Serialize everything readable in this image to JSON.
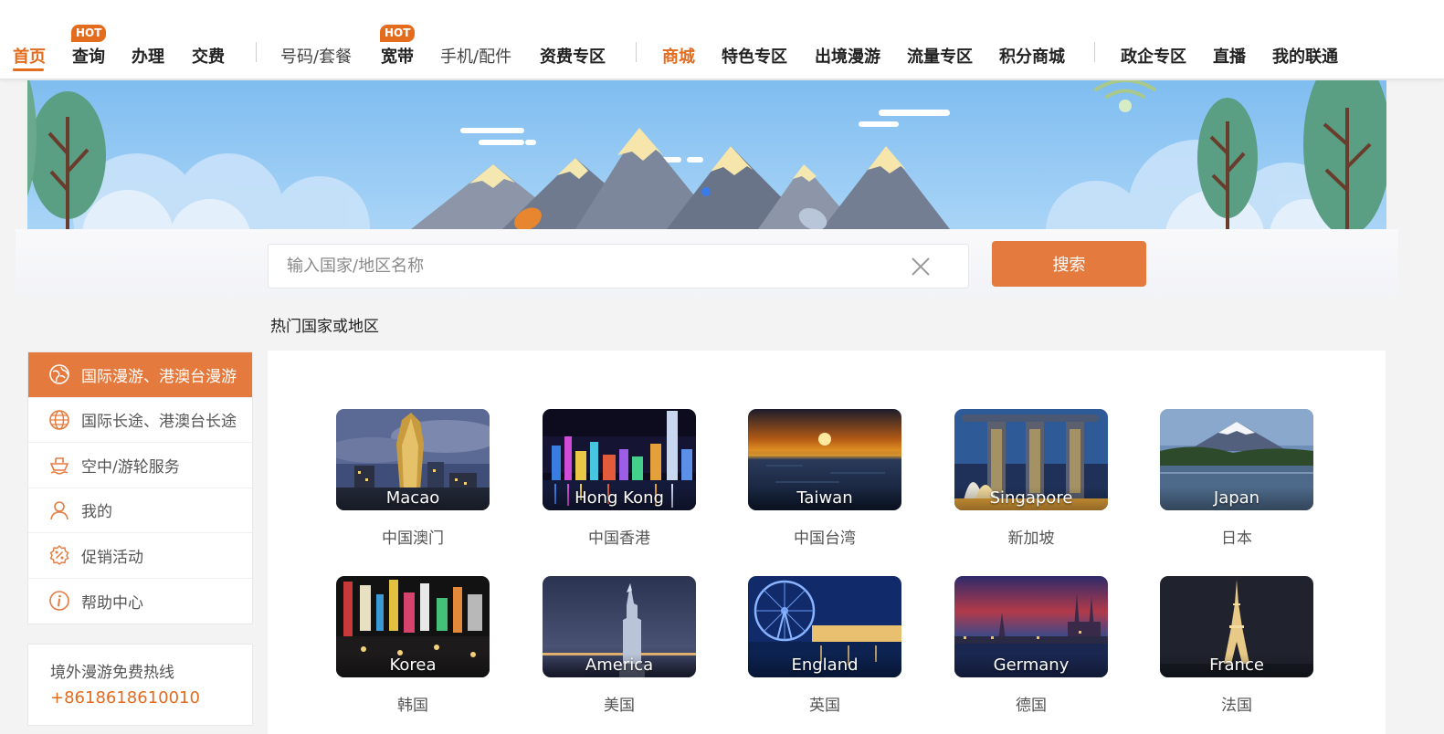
{
  "nav": {
    "items": [
      {
        "label": "首页",
        "hot": false
      },
      {
        "label": "查询",
        "hot": true
      },
      {
        "label": "办理",
        "hot": false
      },
      {
        "label": "交费",
        "hot": false
      },
      {
        "label": "号码/套餐",
        "hot": false
      },
      {
        "label": "宽带",
        "hot": true
      },
      {
        "label": "手机/配件",
        "hot": false
      },
      {
        "label": "资费专区",
        "hot": false
      },
      {
        "label": "商城",
        "hot": false
      },
      {
        "label": "特色专区",
        "hot": false
      },
      {
        "label": "出境漫游",
        "hot": false
      },
      {
        "label": "流量专区",
        "hot": false
      },
      {
        "label": "积分商城",
        "hot": false
      },
      {
        "label": "政企专区",
        "hot": false
      },
      {
        "label": "直播",
        "hot": false
      },
      {
        "label": "我的联通",
        "hot": false
      }
    ],
    "hot_badge": "HOT",
    "active_index": 0
  },
  "search": {
    "placeholder": "输入国家/地区名称",
    "value": "",
    "button_label": "搜索"
  },
  "hot_regions_title": "热门国家或地区",
  "sidebar": {
    "items": [
      {
        "label": "国际漫游、港澳台漫游",
        "icon": "globe-roaming-icon",
        "active": true
      },
      {
        "label": "国际长途、港澳台长途",
        "icon": "globe-icon",
        "active": false
      },
      {
        "label": "空中/游轮服务",
        "icon": "ship-icon",
        "active": false
      },
      {
        "label": "我的",
        "icon": "user-icon",
        "active": false
      },
      {
        "label": "促销活动",
        "icon": "discount-icon",
        "active": false
      },
      {
        "label": "帮助中心",
        "icon": "info-icon",
        "active": false
      }
    ]
  },
  "hotline": {
    "label": "境外漫游免费热线",
    "number": "+8618618610010"
  },
  "destinations": [
    {
      "en": "Macao",
      "cn": "中国澳门"
    },
    {
      "en": "Hong Kong",
      "cn": "中国香港"
    },
    {
      "en": "Taiwan",
      "cn": "中国台湾"
    },
    {
      "en": "Singapore",
      "cn": "新加坡"
    },
    {
      "en": "Japan",
      "cn": "日本"
    },
    {
      "en": "Korea",
      "cn": "韩国"
    },
    {
      "en": "America",
      "cn": "美国"
    },
    {
      "en": "England",
      "cn": "英国"
    },
    {
      "en": "Germany",
      "cn": "德国"
    },
    {
      "en": "France",
      "cn": "法国"
    }
  ],
  "colors": {
    "accent": "#e46c1f",
    "button": "#e57a3f"
  }
}
